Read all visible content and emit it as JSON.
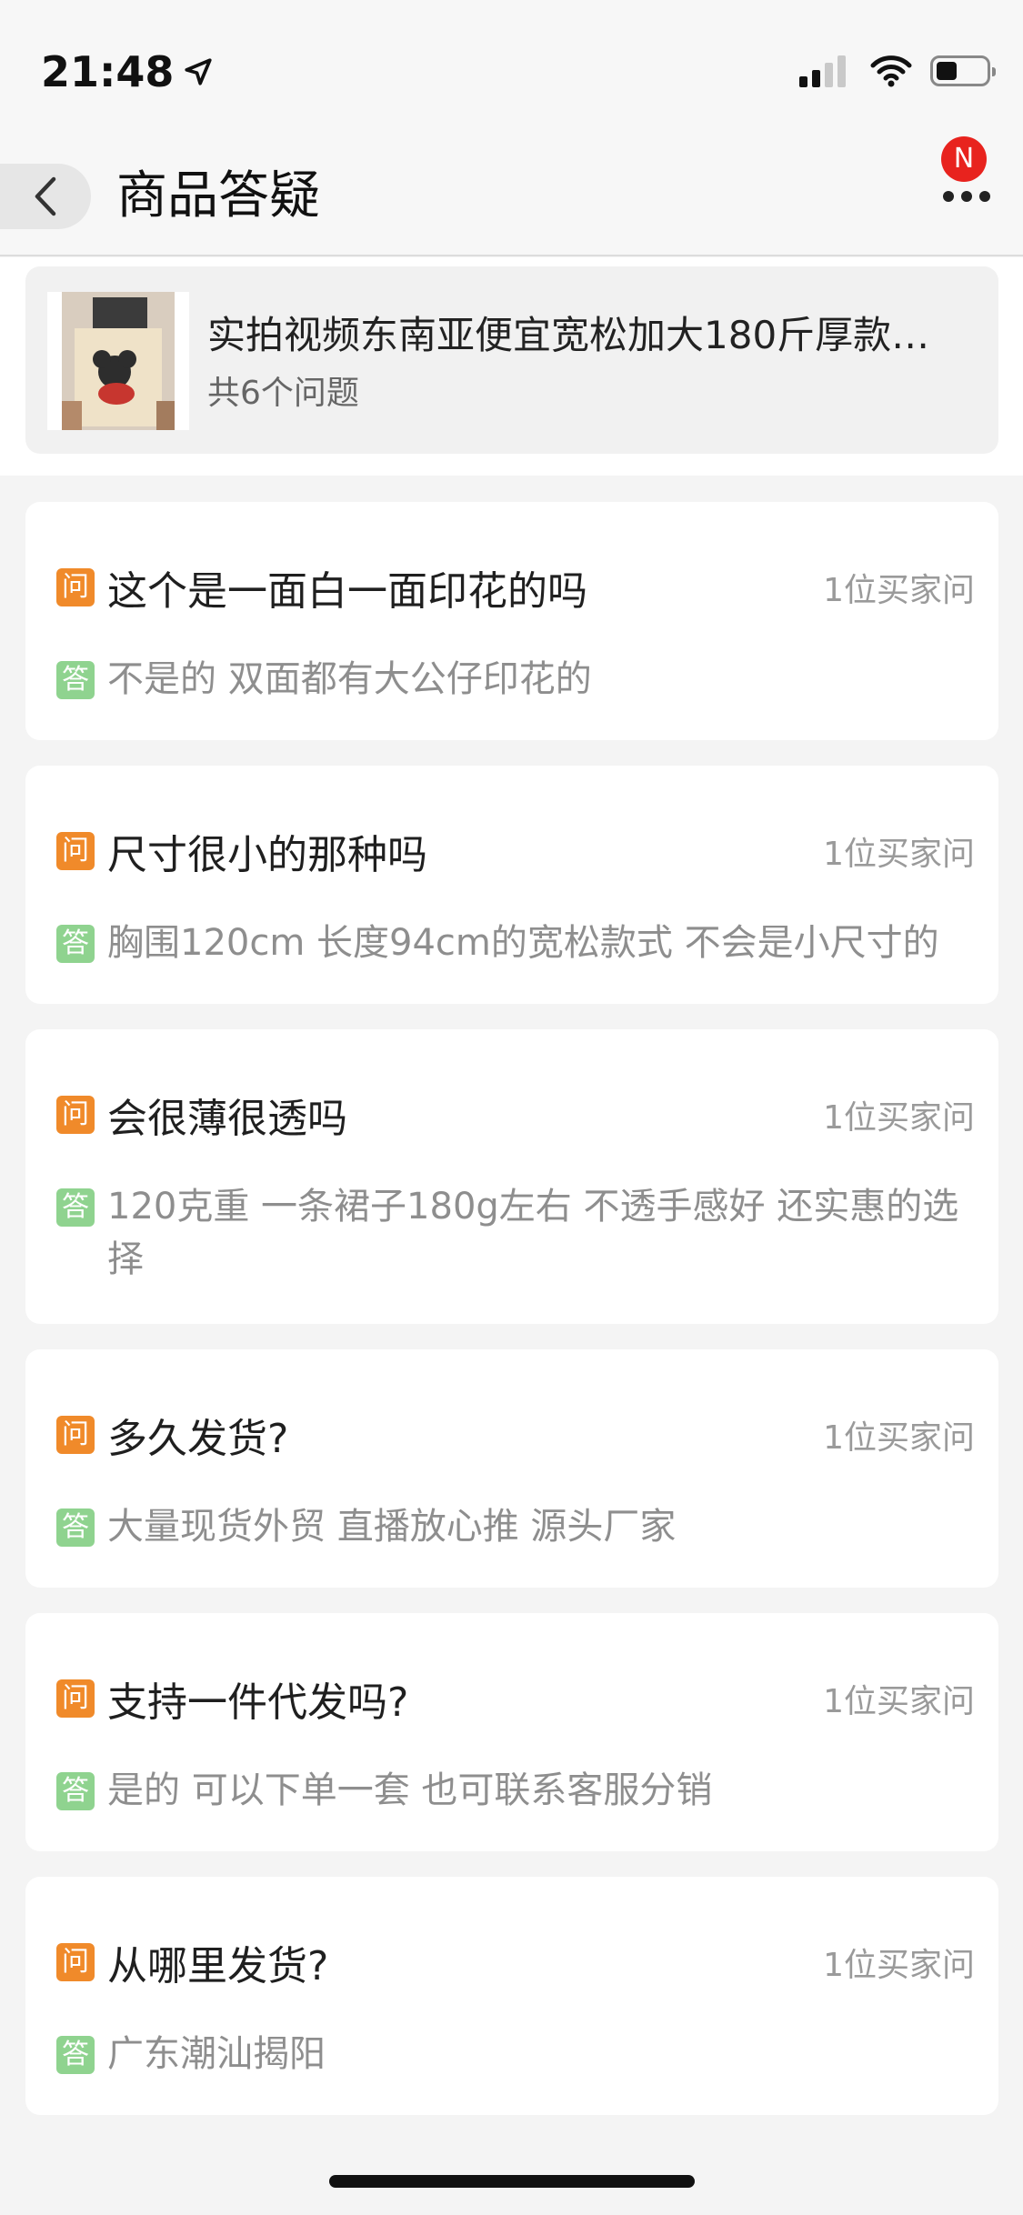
{
  "status": {
    "time": "21:48"
  },
  "nav": {
    "title": "商品答疑",
    "notice_badge": "N"
  },
  "product": {
    "name": "实拍视频东南亚便宜宽松加大180斤厚款…",
    "question_count": "共6个问题"
  },
  "labels": {
    "question_badge": "问",
    "answer_badge": "答"
  },
  "qa": [
    {
      "question": "这个是一面白一面印花的吗",
      "meta": "1位买家问",
      "answer": "不是的 双面都有大公仔印花的"
    },
    {
      "question": "尺寸很小的那种吗",
      "meta": "1位买家问",
      "answer": "胸围120cm 长度94cm的宽松款式 不会是小尺寸的"
    },
    {
      "question": "会很薄很透吗",
      "meta": "1位买家问",
      "answer": "120克重 一条裙子180g左右 不透手感好 还实惠的选择"
    },
    {
      "question": "多久发货?",
      "meta": "1位买家问",
      "answer": "大量现货外贸 直播放心推  源头厂家"
    },
    {
      "question": "支持一件代发吗?",
      "meta": "1位买家问",
      "answer": "是的 可以下单一套 也可联系客服分销"
    },
    {
      "question": "从哪里发货?",
      "meta": "1位买家问",
      "answer": "广东潮汕揭阳"
    }
  ]
}
